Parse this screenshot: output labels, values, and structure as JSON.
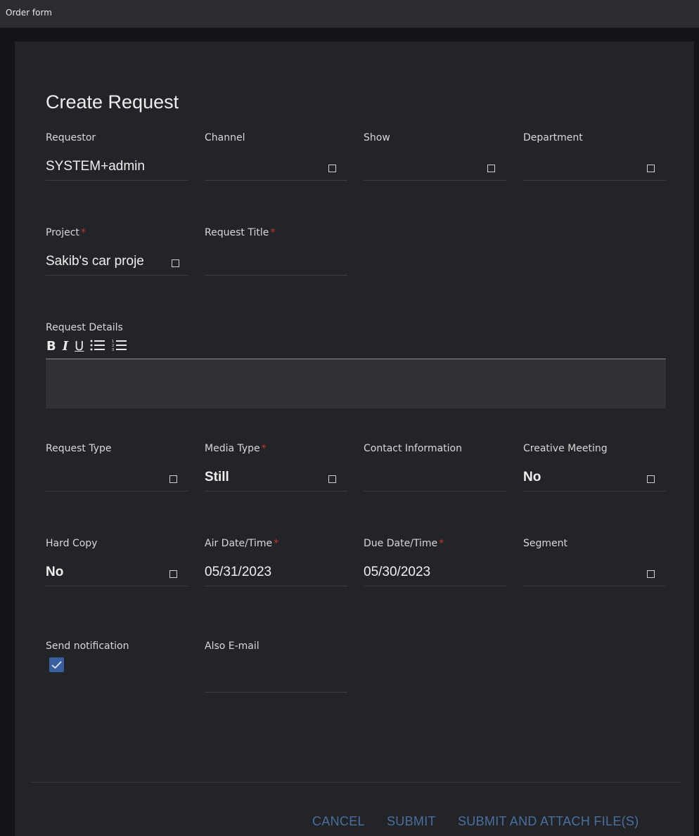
{
  "window": {
    "title": "Order form"
  },
  "form": {
    "heading": "Create Request",
    "requestor": {
      "label": "Requestor",
      "value": "SYSTEM+admin"
    },
    "channel": {
      "label": "Channel",
      "value": ""
    },
    "show": {
      "label": "Show",
      "value": ""
    },
    "department": {
      "label": "Department",
      "value": ""
    },
    "project": {
      "label": "Project",
      "required": "*",
      "value": "Sakib's car proje"
    },
    "request_title": {
      "label": "Request Title",
      "required": "*",
      "value": ""
    },
    "request_details": {
      "label": "Request Details",
      "value": ""
    },
    "request_type": {
      "label": "Request Type",
      "value": ""
    },
    "media_type": {
      "label": "Media Type",
      "required": "*",
      "value": "Still"
    },
    "contact_information": {
      "label": "Contact Information",
      "value": ""
    },
    "creative_meeting": {
      "label": "Creative Meeting",
      "value": "No"
    },
    "hard_copy": {
      "label": "Hard Copy",
      "value": "No"
    },
    "air_date_time": {
      "label": "Air Date/Time",
      "required": "*",
      "value": "05/31/2023"
    },
    "due_date_time": {
      "label": "Due Date/Time",
      "required": "*",
      "value": "05/30/2023"
    },
    "segment": {
      "label": "Segment",
      "value": ""
    },
    "send_notification": {
      "label": "Send notification",
      "checked": true
    },
    "also_email": {
      "label": "Also E-mail",
      "value": ""
    }
  },
  "toolbar": {
    "bold": "B",
    "italic": "I",
    "underline": "U",
    "bullet_list": "☰",
    "numbered_list": "☷"
  },
  "actions": {
    "cancel": "CANCEL",
    "submit": "SUBMIT",
    "submit_attach": "SUBMIT AND ATTACH FILE(S)"
  },
  "colors": {
    "accent": "#4a6f9e",
    "required": "#c0392b",
    "checkbox": "#3a5fa0"
  }
}
